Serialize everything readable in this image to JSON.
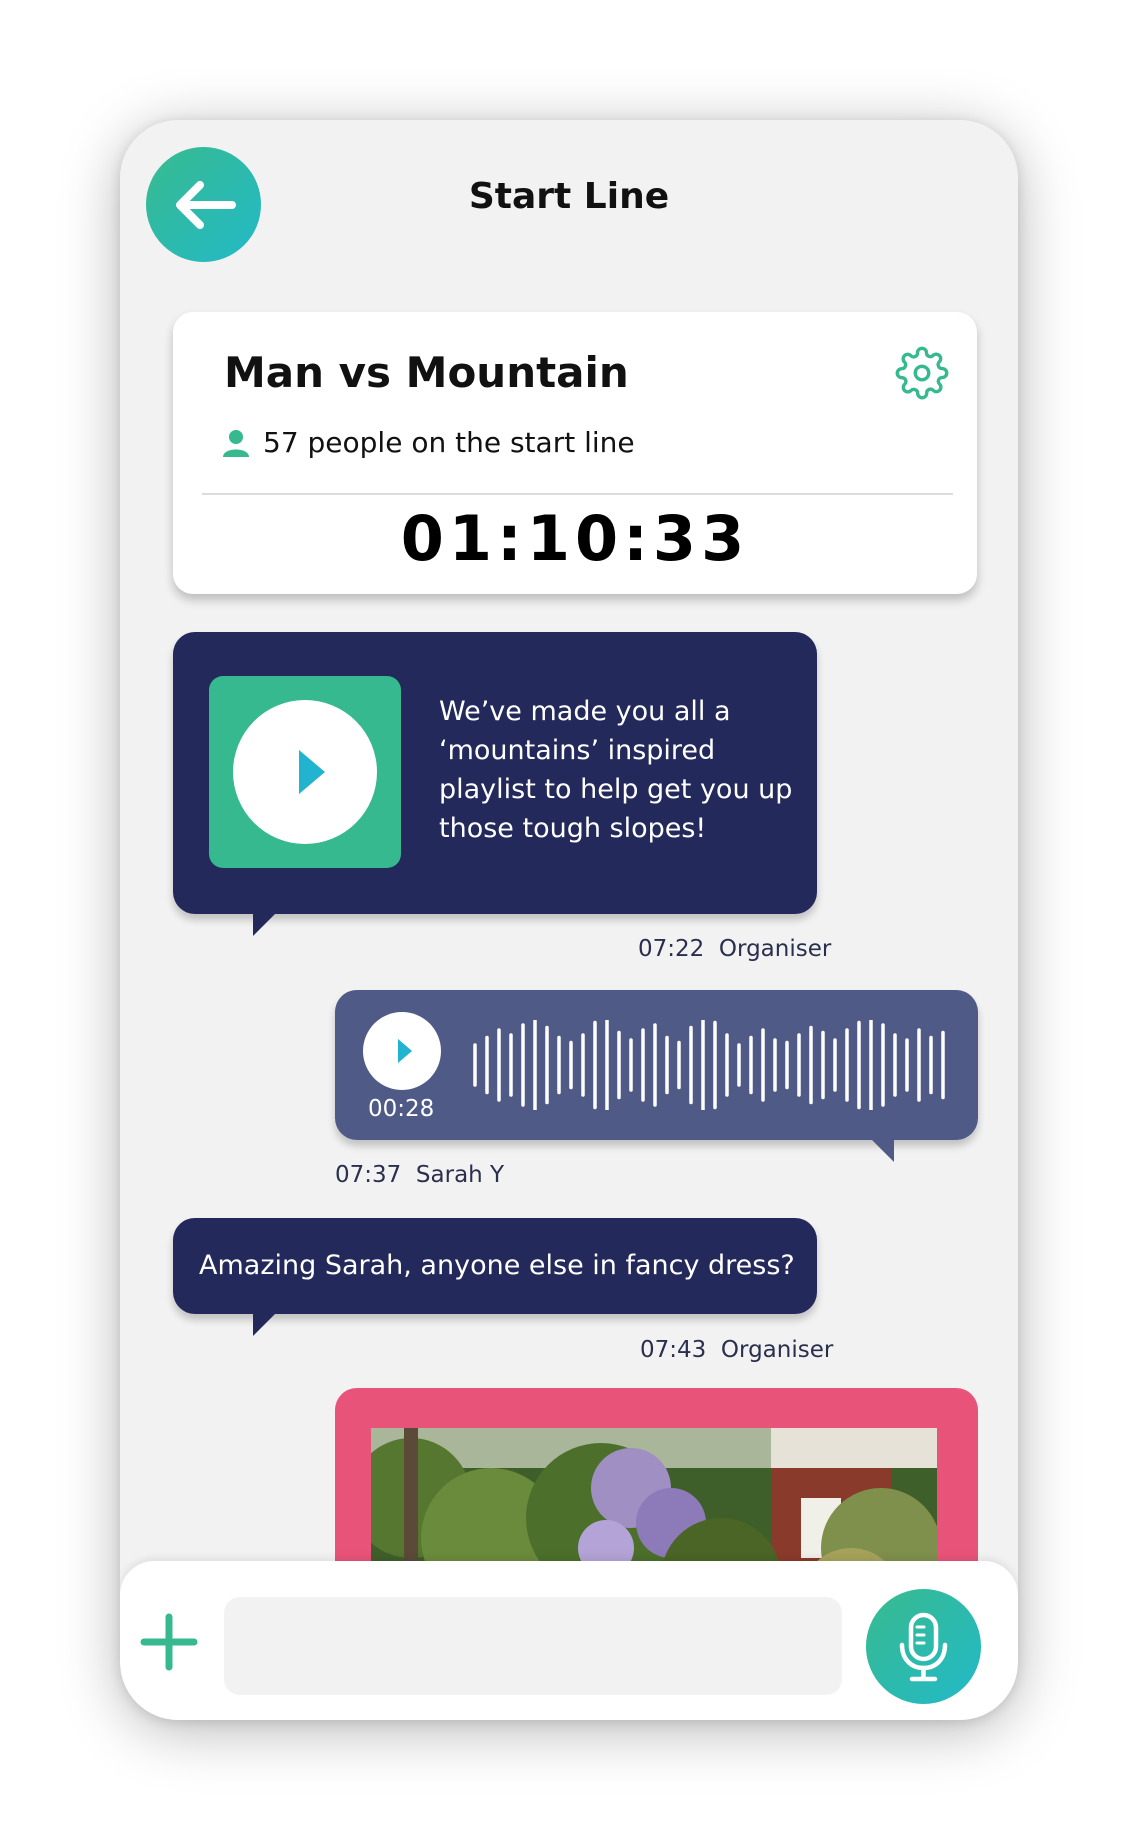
{
  "header": {
    "title": "Start Line",
    "back_icon": "arrow-left-icon"
  },
  "event": {
    "name": "Man vs Mountain",
    "participants": "57 people on the start line",
    "timer": "01:10:33",
    "settings_icon": "gear-icon",
    "person_icon": "person-icon"
  },
  "messages": [
    {
      "type": "playlist",
      "text": "We’ve made you all a ‘mountains’ inspired playlist to help get you up those tough slopes!",
      "time": "07:22",
      "author": "Organiser"
    },
    {
      "type": "voice",
      "duration": "00:28",
      "time": "07:37",
      "author": "Sarah Y"
    },
    {
      "type": "text",
      "text": "Amazing Sarah, anyone else in fancy dress?",
      "time": "07:43",
      "author": "Organiser"
    },
    {
      "type": "photo"
    }
  ],
  "composer": {
    "placeholder": "",
    "add_icon": "plus-icon",
    "mic_icon": "microphone-icon"
  },
  "colors": {
    "accent": "#38bb8e",
    "accent2": "#22b9c8",
    "navy": "#23295a",
    "voice": "#4f5a87",
    "photo_frame": "#e8537a"
  }
}
